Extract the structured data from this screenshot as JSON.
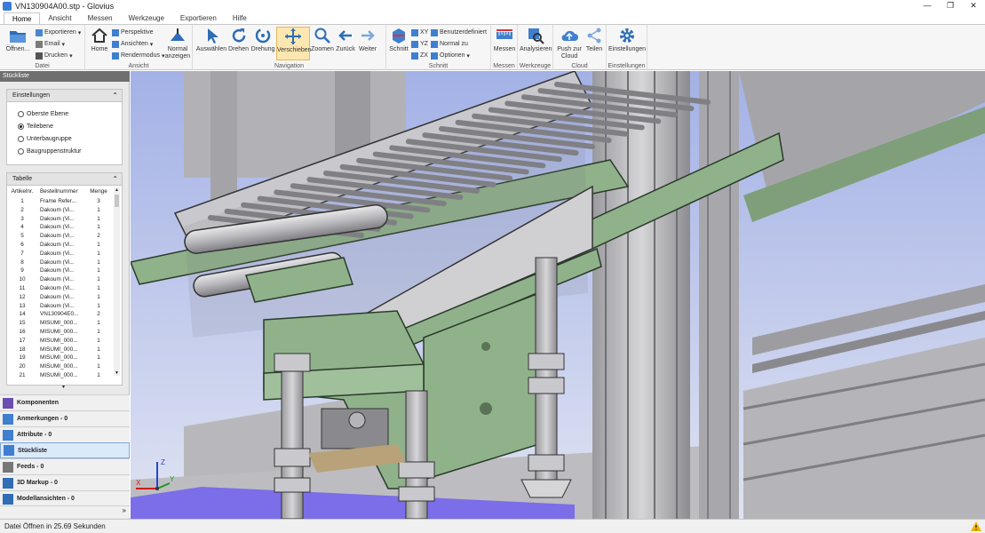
{
  "window": {
    "title": "VN130904A00.stp - Glovius",
    "min": "—",
    "max": "❐",
    "close": "✕"
  },
  "tabs": [
    "Home",
    "Ansicht",
    "Messen",
    "Werkzeuge",
    "Exportieren",
    "Hilfe"
  ],
  "ribbon": {
    "datei": {
      "label": "Datei",
      "open": "Öffnen...",
      "export": "Exportieren",
      "email": "Email",
      "print": "Drucken"
    },
    "ansicht": {
      "label": "Ansicht",
      "home": "Home",
      "perspective": "Perspektive",
      "views": "Ansichten",
      "rendermode": "Rendermodus",
      "normal_view": "Normal anzeigen"
    },
    "navigation": {
      "label": "Navigation",
      "select": "Auswählen",
      "rotate": "Drehen",
      "turn": "Drehung",
      "pan": "Verschieben",
      "zoom": "Zoomen",
      "back": "Zurück",
      "forward": "Weiter"
    },
    "schnitt": {
      "label": "Schnitt",
      "section": "Schnitt",
      "xy": "XY",
      "yz": "YZ",
      "zx": "ZX",
      "custom": "Benutzerdefiniert",
      "normal_to": "Normal zu",
      "options": "Optionen"
    },
    "messen": {
      "label": "Messen",
      "measure": "Messen"
    },
    "werkzeuge": {
      "label": "Werkzeuge",
      "analyze": "Analysieren"
    },
    "cloud": {
      "label": "Cloud",
      "push": "Push zur Cloud",
      "share": "Teilen"
    },
    "einstellungen": {
      "label": "Einstellungen",
      "settings": "Einstellungen"
    }
  },
  "left_panel": {
    "title": "Stückliste",
    "settings": {
      "header": "Einstellungen",
      "options": [
        {
          "label": "Oberste Ebene",
          "checked": false
        },
        {
          "label": "Teilebene",
          "checked": true
        },
        {
          "label": "Unterbaugruppe",
          "checked": false
        },
        {
          "label": "Baugruppenstruktur",
          "checked": false
        }
      ]
    },
    "table": {
      "header": "Tabelle",
      "columns": [
        "Artikelnr.",
        "Bestellnummer",
        "Menge"
      ],
      "rows": [
        [
          "1",
          "Frame Refer...",
          "3"
        ],
        [
          "2",
          "Dakoum (Vi...",
          "1"
        ],
        [
          "3",
          "Dakoum (Vi...",
          "1"
        ],
        [
          "4",
          "Dakoum (Vi...",
          "1"
        ],
        [
          "5",
          "Dakoum (Vi...",
          "2"
        ],
        [
          "6",
          "Dakoum (Vi...",
          "1"
        ],
        [
          "7",
          "Dakoum (Vi...",
          "1"
        ],
        [
          "8",
          "Dakoum (Vi...",
          "1"
        ],
        [
          "9",
          "Dakoum (Vi...",
          "1"
        ],
        [
          "10",
          "Dakoum (Vi...",
          "1"
        ],
        [
          "11",
          "Dakoum (Vi...",
          "1"
        ],
        [
          "12",
          "Dakoum (Vi...",
          "1"
        ],
        [
          "13",
          "Dakoum (Vi...",
          "1"
        ],
        [
          "14",
          "VN130904E0...",
          "2"
        ],
        [
          "15",
          "MISUMI_000...",
          "1"
        ],
        [
          "16",
          "MISUMI_000...",
          "1"
        ],
        [
          "17",
          "MISUMI_000...",
          "1"
        ],
        [
          "18",
          "MISUMI_000...",
          "1"
        ],
        [
          "19",
          "MISUMI_000...",
          "1"
        ],
        [
          "20",
          "MISUMI_000...",
          "1"
        ],
        [
          "21",
          "MISUMI_000...",
          "1"
        ]
      ]
    },
    "nav": [
      {
        "label": "Komponenten",
        "active": false
      },
      {
        "label": "Anmerkungen - 0",
        "active": false
      },
      {
        "label": "Attribute - 0",
        "active": false
      },
      {
        "label": "Stückliste",
        "active": true
      },
      {
        "label": "Feeds - 0",
        "active": false
      },
      {
        "label": "3D Markup - 0",
        "active": false
      },
      {
        "label": "Modellansichten - 0",
        "active": false
      }
    ]
  },
  "viewport": {
    "axes": {
      "x": "X",
      "y": "Y",
      "z": "Z"
    }
  },
  "status": {
    "message": "Datei Öffnen in 25.69 Sekunden"
  },
  "colors": {
    "accent": "#2b6fc9",
    "active_tool_bg": "#fce7b0",
    "model_green": "#8fb28a",
    "model_steel": "#b9b9bc",
    "viewport_bg": "#b4bfe8"
  }
}
